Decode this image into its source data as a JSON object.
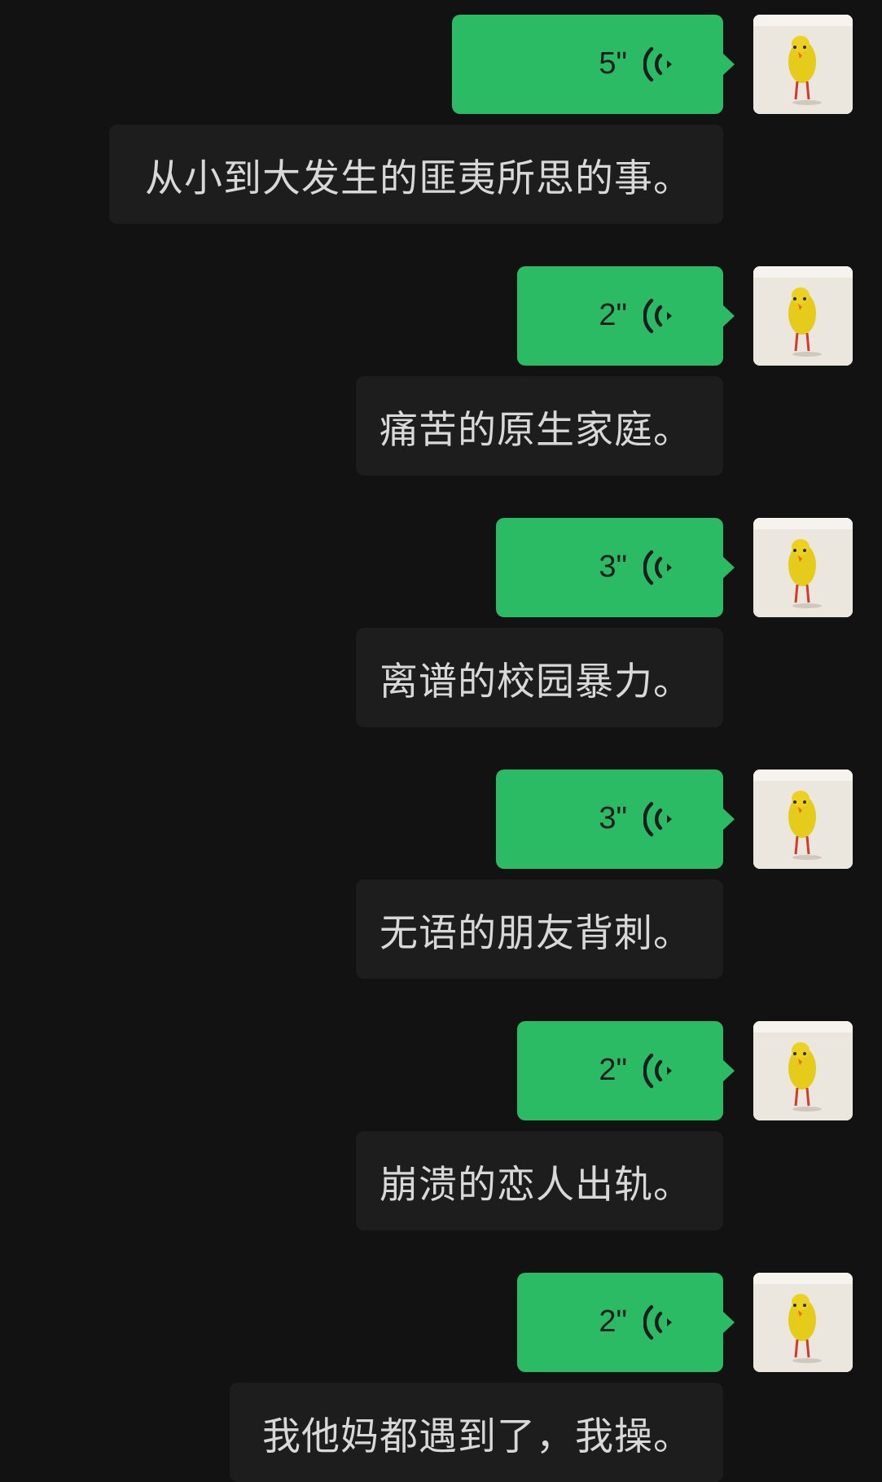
{
  "messages": [
    {
      "voice_duration": "5\"",
      "text": "从小到大发生的匪夷所思的事。"
    },
    {
      "voice_duration": "2\"",
      "text": "痛苦的原生家庭。"
    },
    {
      "voice_duration": "3\"",
      "text": "离谱的校园暴力。"
    },
    {
      "voice_duration": "3\"",
      "text": "无语的朋友背刺。"
    },
    {
      "voice_duration": "2\"",
      "text": "崩溃的恋人出轨。"
    },
    {
      "voice_duration": "2\"",
      "text": "我他妈都遇到了，我操。"
    }
  ],
  "colors": {
    "background": "#121212",
    "voice_bubble": "#2bbb64",
    "text_bubble": "#1d1d1d",
    "text": "#d8d8d8"
  },
  "icons": {
    "voice": "voice-playback-icon",
    "avatar": "yellow-chick-avatar"
  }
}
